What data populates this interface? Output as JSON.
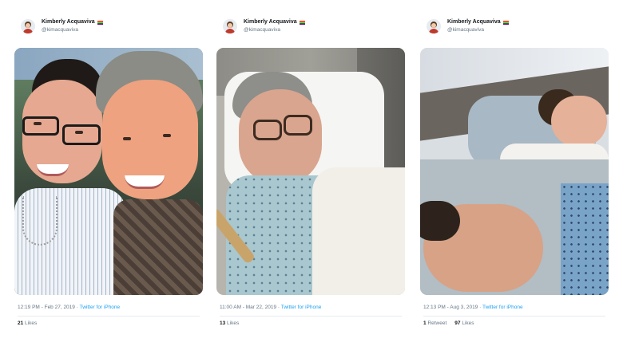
{
  "tweets": [
    {
      "author": {
        "name": "Kimberly Acquaviva",
        "handle": "@kimacquaviva"
      },
      "timestamp": "12:19 PM - Feb 27, 2019",
      "source": "Twitter for iPhone",
      "retweets": "",
      "retweets_label": "",
      "likes": "21",
      "likes_label": "Likes"
    },
    {
      "author": {
        "name": "Kimberly Acquaviva",
        "handle": "@kimacquaviva"
      },
      "timestamp": "11:00 AM - Mar 22, 2019",
      "source": "Twitter for iPhone",
      "retweets": "",
      "retweets_label": "",
      "likes": "13",
      "likes_label": "Likes"
    },
    {
      "author": {
        "name": "Kimberly Acquaviva",
        "handle": "@kimacquaviva"
      },
      "timestamp": "12:13 PM - Aug 3, 2019",
      "source": "Twitter for iPhone",
      "retweets": "1",
      "retweets_label": "Retweet",
      "likes": "97",
      "likes_label": "Likes"
    }
  ],
  "separator": " · ",
  "colors": {
    "link": "#1da1f2",
    "muted": "#657786",
    "text": "#14171a"
  },
  "icons": {
    "flag": "rainbow-flag-icon",
    "avatar": "profile-avatar"
  }
}
